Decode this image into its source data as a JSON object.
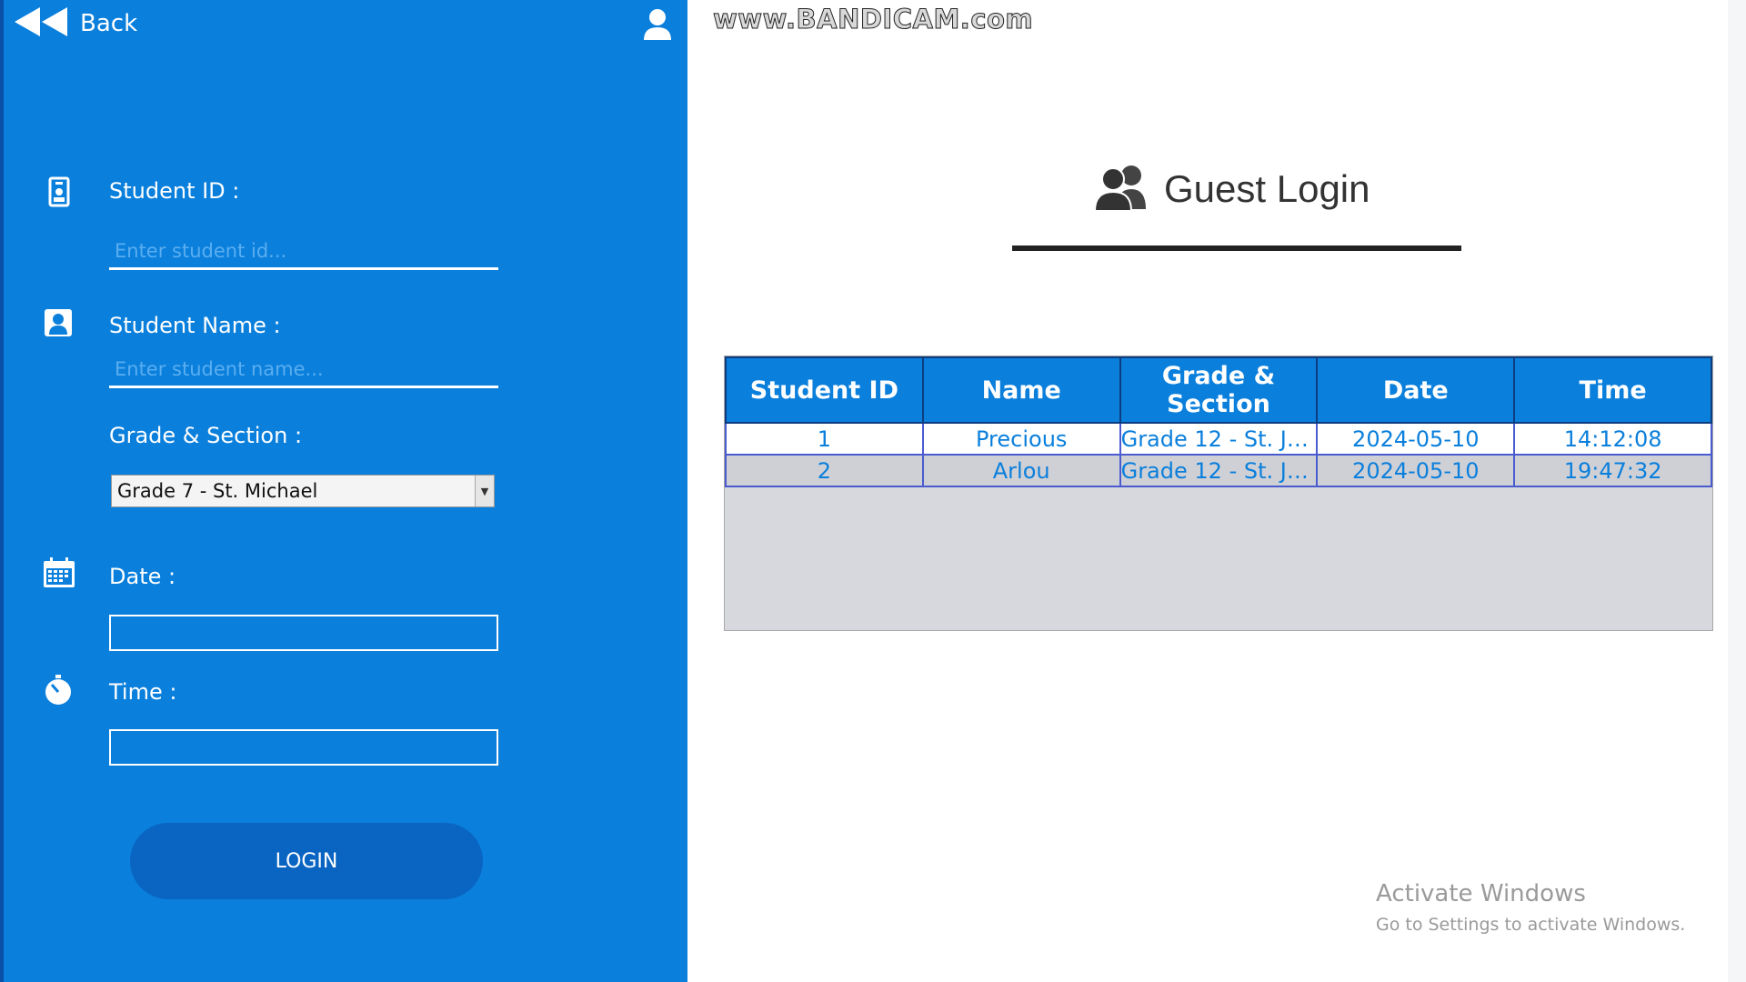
{
  "colors": {
    "sidebar": "#0a7fdc",
    "login_button": "#0a65c2",
    "table_header": "#0a7fdc",
    "table_text": "#0a7fdc"
  },
  "nav": {
    "back_label": "Back"
  },
  "watermark": "www.BANDICAM.com",
  "form": {
    "student_id_label": "Student ID :",
    "student_id_placeholder": "Enter student id...",
    "student_id_value": "",
    "student_name_label": "Student Name :",
    "student_name_placeholder": "Enter student name...",
    "student_name_value": "",
    "grade_label": "Grade & Section :",
    "grade_selected": "Grade 7 - St. Michael",
    "date_label": "Date :",
    "date_value": "",
    "time_label": "Time :",
    "time_value": "",
    "login_label": "LOGIN"
  },
  "page": {
    "title": "Guest Login",
    "title_icon": "users-icon"
  },
  "table": {
    "headers": [
      "Student ID",
      "Name",
      "Grade & Section",
      "Date",
      "Time"
    ],
    "rows": [
      [
        "1",
        "Precious",
        "Grade 12 - St. Jo...",
        "2024-05-10",
        "14:12:08"
      ],
      [
        "2",
        "Arlou",
        "Grade 12 - St. Jo...",
        "2024-05-10",
        "19:47:32"
      ]
    ]
  },
  "system": {
    "activate_title": "Activate Windows",
    "activate_sub": "Go to Settings to activate Windows."
  }
}
